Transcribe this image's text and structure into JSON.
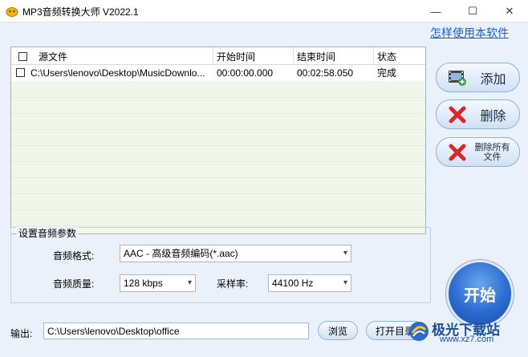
{
  "window": {
    "title": "MP3音频转换大师 V2022.1",
    "minimize": "—",
    "maximize": "☐",
    "close": "✕"
  },
  "file_list": {
    "columns": [
      "源文件",
      "开始时间",
      "结束时间",
      "状态"
    ],
    "rows": [
      {
        "source": "C:\\Users\\lenovo\\Desktop\\MusicDownlo...",
        "start": "00:00:00.000",
        "end": "00:02:58.050",
        "status": "完成"
      }
    ]
  },
  "help_link": "怎样使用本软件",
  "side_buttons": {
    "add": "添加",
    "delete": "删除",
    "delete_all": "删除所有文件"
  },
  "params": {
    "legend": "设置音频参数",
    "format_label": "音频格式:",
    "format_value": "AAC - 高级音频编码(*.aac)",
    "quality_label": "音频质量:",
    "quality_value": "128 kbps",
    "samplerate_label": "采样率:",
    "samplerate_value": "44100 Hz"
  },
  "start_button": "开始",
  "output": {
    "label": "输出:",
    "path": "C:\\Users\\lenovo\\Desktop\\office",
    "browse": "浏览",
    "open_dir": "打开目录"
  },
  "watermark": {
    "text": "极光下载站",
    "url": "www.xz7.com"
  },
  "colors": {
    "accent": "#2b6bd0",
    "link": "#1a5fd0",
    "delete_red": "#d8262b",
    "list_bg": "#f1f7e8"
  }
}
